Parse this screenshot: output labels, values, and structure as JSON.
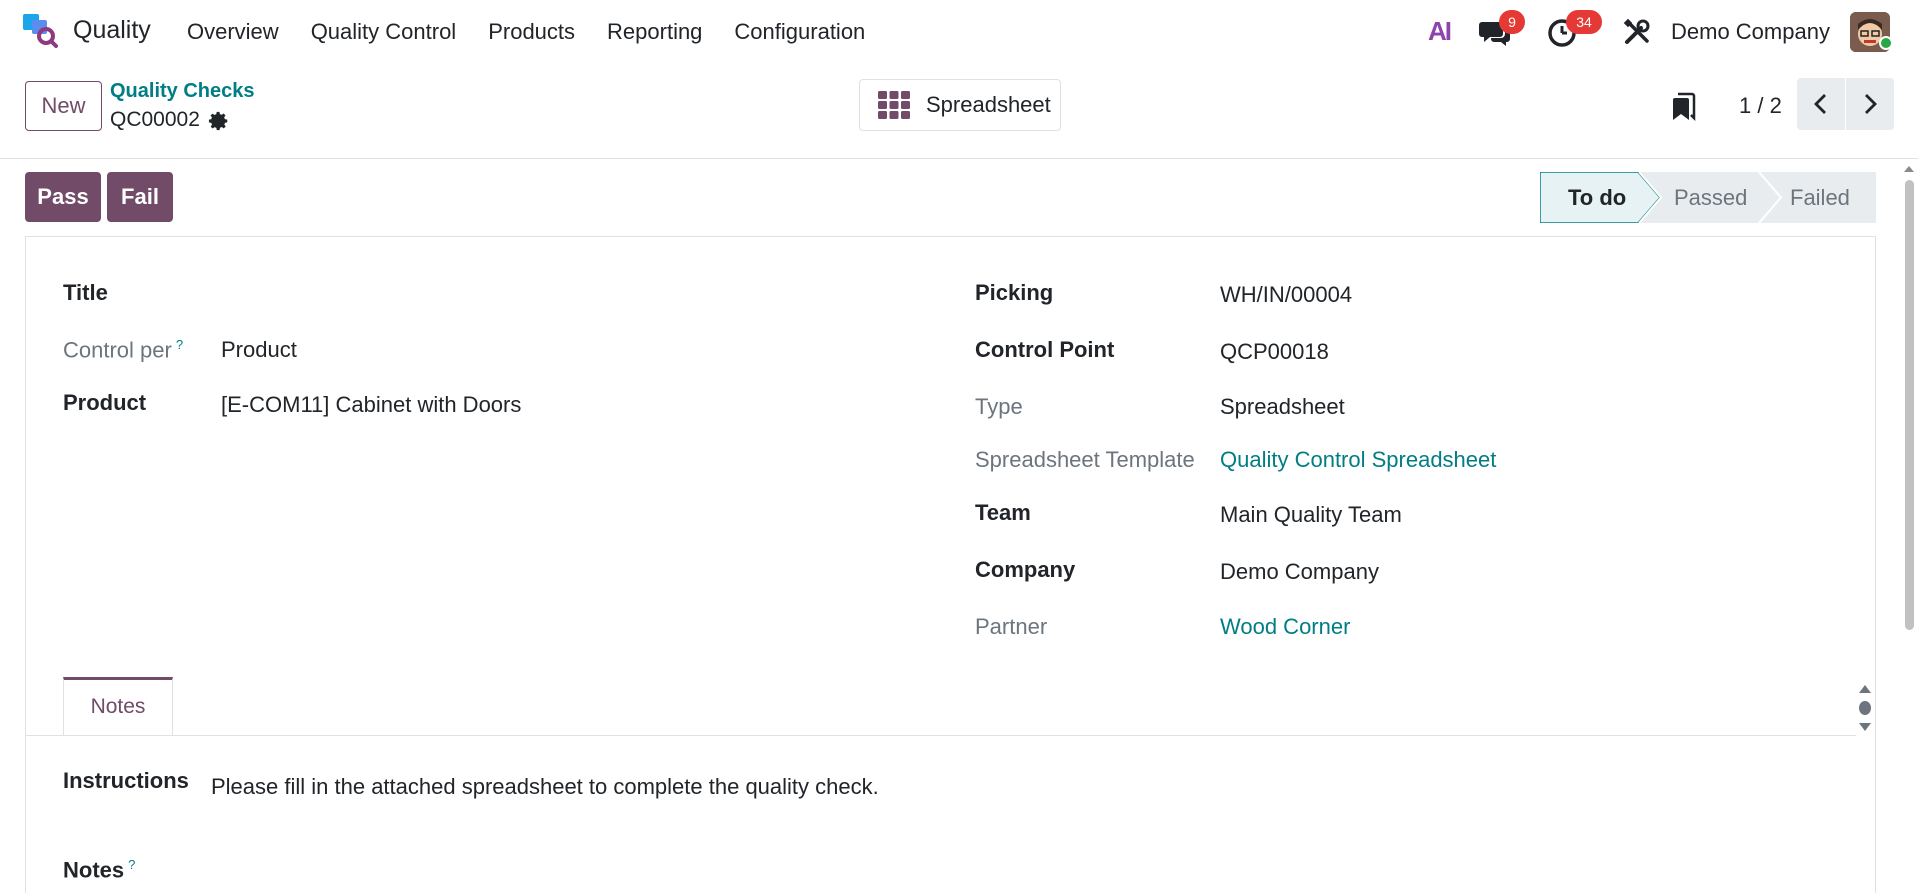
{
  "navbar": {
    "app_name": "Quality",
    "menu": [
      "Overview",
      "Quality Control",
      "Products",
      "Reporting",
      "Configuration"
    ],
    "ai_label": "AI",
    "chat_count": "9",
    "activity_count": "34",
    "company": "Demo Company"
  },
  "control_panel": {
    "new_label": "New",
    "breadcrumb": "Quality Checks",
    "record_name": "QC00002",
    "spreadsheet_label": "Spreadsheet",
    "pager": "1 / 2"
  },
  "actions": {
    "pass_label": "Pass",
    "fail_label": "Fail"
  },
  "status": {
    "stages": [
      "To do",
      "Passed",
      "Failed"
    ],
    "current": "To do"
  },
  "form": {
    "left": {
      "title_label": "Title",
      "control_per_label": "Control per",
      "control_per_value": "Product",
      "product_label": "Product",
      "product_value": "[E-COM11] Cabinet with Doors"
    },
    "right": {
      "picking_label": "Picking",
      "picking_value": "WH/IN/00004",
      "control_point_label": "Control Point",
      "control_point_value": "QCP00018",
      "type_label": "Type",
      "type_value": "Spreadsheet",
      "template_label": "Spreadsheet Template",
      "template_value": "Quality Control Spreadsheet",
      "team_label": "Team",
      "team_value": "Main Quality Team",
      "company_label": "Company",
      "company_value": "Demo Company",
      "partner_label": "Partner",
      "partner_value": "Wood Corner"
    },
    "help_mark": "?"
  },
  "notebook": {
    "tab_label": "Notes",
    "instructions_label": "Instructions",
    "instructions_value": "Please fill in the attached spreadsheet to complete the quality check.",
    "notes_label": "Notes"
  },
  "colors": {
    "primary": "#714b67",
    "link": "#017e84",
    "badge": "#e53935"
  }
}
